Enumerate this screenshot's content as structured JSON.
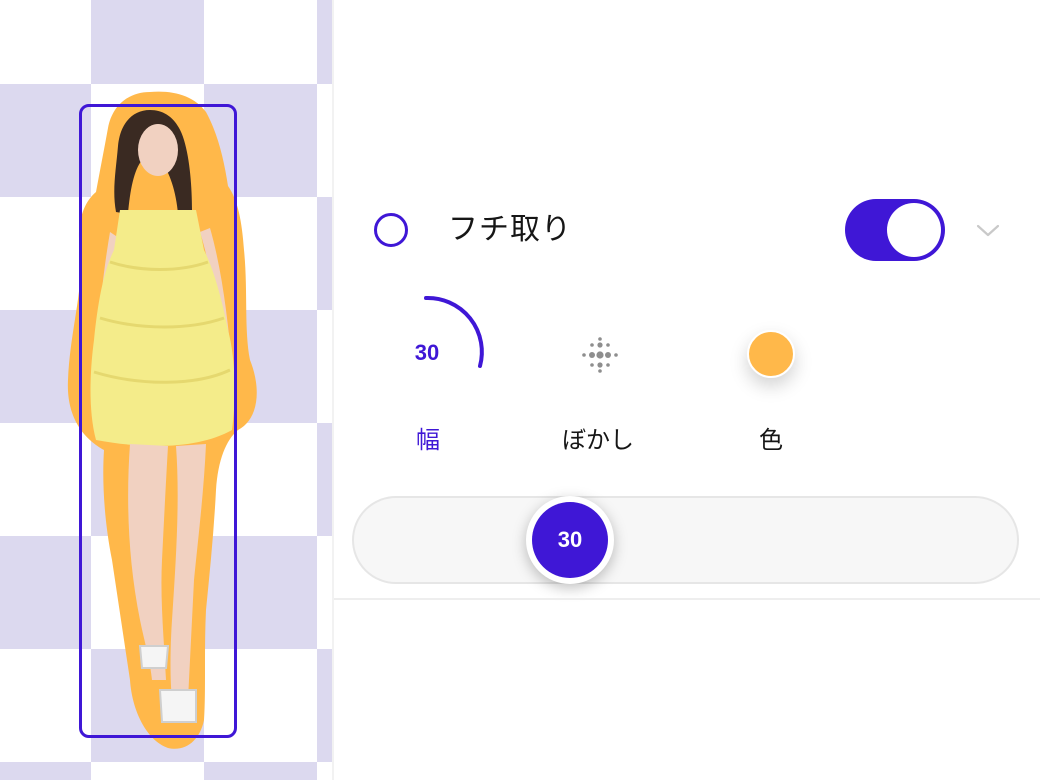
{
  "canvas": {
    "checker_color": "#dcd9ef",
    "outline_color": "#ffb84a",
    "frame_color": "#3f17d6"
  },
  "stroke_panel": {
    "title": "フチ取り",
    "enabled": true,
    "accent_color": "#3f17d6",
    "icons": {
      "radio": "radio-circle-icon",
      "toggle": "toggle-switch-icon",
      "expand": "chevron-down-icon"
    },
    "width_value": "30",
    "options": [
      {
        "id": "width",
        "label": "幅",
        "icon": "arc-dial-icon",
        "selected": true
      },
      {
        "id": "blur",
        "label": "ぼかし",
        "icon": "blur-dots-icon",
        "selected": false
      },
      {
        "id": "color",
        "label": "色",
        "icon": "color-swatch-icon",
        "selected": false
      }
    ],
    "selected_color": "#ffb84a",
    "slider": {
      "value": "30",
      "level_fraction": 0.33
    }
  }
}
